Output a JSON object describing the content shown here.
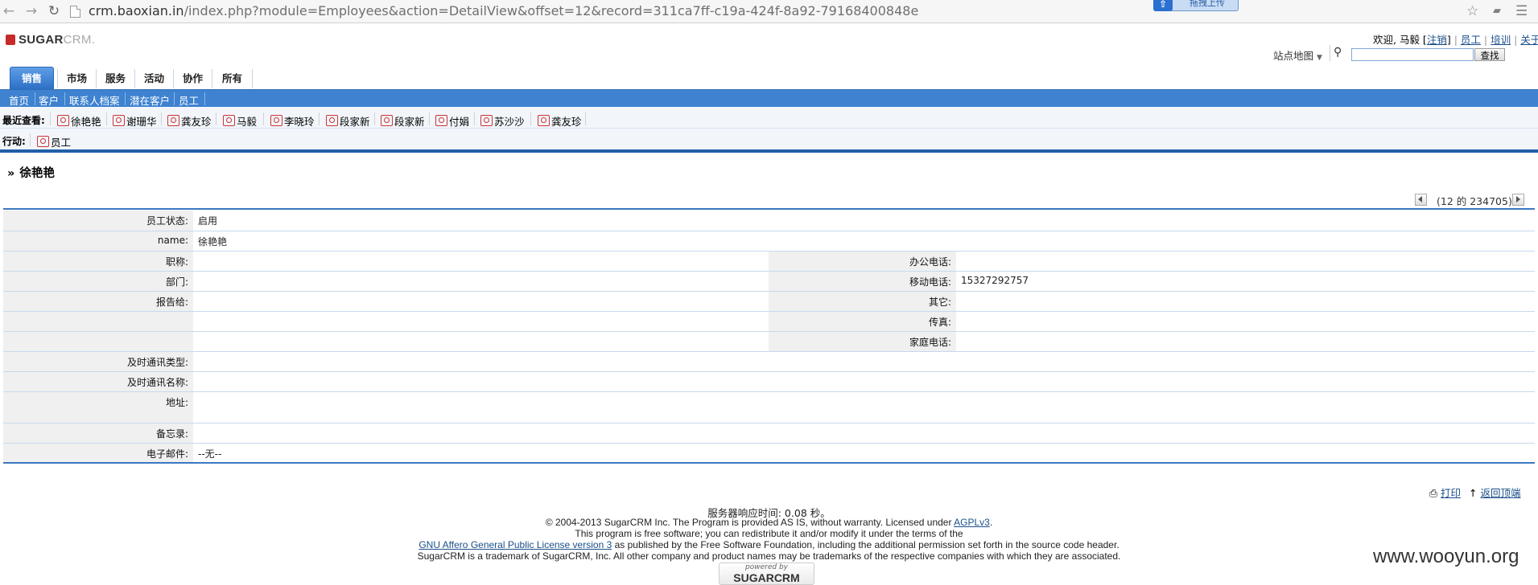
{
  "browser": {
    "url_host": "crm.baoxian.in",
    "url_path": "/index.php?module=Employees&action=DetailView&offset=12&record=311ca7ff-c19a-424f-8a92-79168400848e",
    "upload_badge": "拖拽上传"
  },
  "header": {
    "logo_sugar": "SUGAR",
    "logo_crm": "CRM.",
    "welcome": "欢迎, 马毅",
    "logout": "注销",
    "links": [
      "员工",
      "培训",
      "关于"
    ],
    "sitemap": "站点地图",
    "search_button": "查找",
    "search_value": ""
  },
  "tabs": [
    "销售",
    "市场",
    "服务",
    "活动",
    "协作",
    "所有"
  ],
  "subtabs": [
    "首页",
    "客户",
    "联系人档案",
    "潜在客户",
    "员工"
  ],
  "recent": {
    "label": "最近查看:",
    "items": [
      "徐艳艳",
      "谢珊华",
      "龚友珍",
      "马毅",
      "李晓玲",
      "段家新",
      "段家新",
      "付娟",
      "苏沙沙",
      "龚友珍"
    ]
  },
  "actions": {
    "label": "行动:",
    "item": "员工"
  },
  "record": {
    "title": "徐艳艳",
    "pager": "(12 的 234705)"
  },
  "detail": {
    "status_label": "员工状态:",
    "status_value": "启用",
    "name_label": "name:",
    "name_value": "徐艳艳",
    "title_label": "职称:",
    "title_value": "",
    "office_phone_label": "办公电话:",
    "office_phone_value": "",
    "dept_label": "部门:",
    "dept_value": "",
    "mobile_label": "移动电话:",
    "mobile_value": "15327292757",
    "reports_to_label": "报告给:",
    "reports_to_value": "",
    "other_label": "其它:",
    "other_value": "",
    "fax_label": "传真:",
    "fax_value": "",
    "home_phone_label": "家庭电话:",
    "home_phone_value": "",
    "im_type_label": "及时通讯类型:",
    "im_type_value": "",
    "im_name_label": "及时通讯名称:",
    "im_name_value": "",
    "address_label": "地址:",
    "address_value": "",
    "notes_label": "备忘录:",
    "notes_value": "",
    "email_label": "电子邮件:",
    "email_value": "--无--"
  },
  "footer": {
    "print": "打印",
    "back_to_top": "返回顶端",
    "response_time": "服务器响应时间: 0.08 秒。",
    "copyright": "© 2004-2013 SugarCRM Inc. The Program is provided AS IS, without warranty. Licensed under",
    "license_short": "AGPLv3",
    "free_software": "This program is free software; you can redistribute it and/or modify it under the terms of the",
    "license_long": "GNU Affero General Public License version 3",
    "license_rest": "as published by the Free Software Foundation, including the additional permission set forth in the source code header.",
    "trademark": "SugarCRM is a trademark of SugarCRM, Inc. All other company and product names may be trademarks of the respective companies with which they are associated.",
    "powered_by": "powered by",
    "powered_logo": "SUGARCRM"
  },
  "watermark": "www.wooyun.org"
}
